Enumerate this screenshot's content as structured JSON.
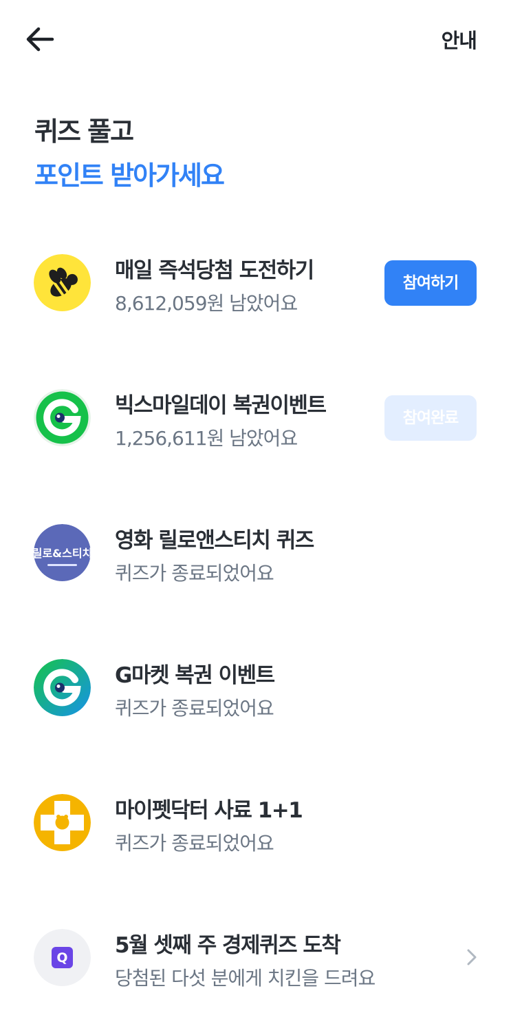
{
  "header": {
    "guide_label": "안내"
  },
  "hero": {
    "title": "퀴즈 풀고",
    "subtitle": "포인트 받아가세요"
  },
  "quizzes": [
    {
      "title": "매일 즉석당첨 도전하기",
      "status": "8,612,059원 남았어요",
      "button": "참여하기",
      "icon": "bee-logo-icon"
    },
    {
      "title": "빅스마일데이 복권이벤트",
      "status": "1,256,611원 남았어요",
      "button": "참여완료",
      "icon": "gmarket-g-icon"
    },
    {
      "title": "영화 릴로앤스티치 퀴즈",
      "status": "퀴즈가 종료되었어요",
      "icon": "lilo-stitch-poster-icon",
      "poster_text": "릴로&스티치"
    },
    {
      "title": "G마켓 복권 이벤트",
      "status": "퀴즈가 종료되었어요",
      "icon": "gmarket-g-icon"
    },
    {
      "title": "마이펫닥터 사료 1+1",
      "status": "퀴즈가 종료되었어요",
      "icon": "pet-doctor-icon"
    },
    {
      "title": "5월 셋째 주 경제퀴즈 도착",
      "status": "당첨된 다섯 분에게 치킨을 드려요",
      "icon": "quiz-q-icon",
      "icon_letter": "Q"
    }
  ],
  "colors": {
    "accent": "#3182f6",
    "button_done_bg": "#e3eeff",
    "title": "#2a2f36",
    "subtext": "#6b7684"
  }
}
